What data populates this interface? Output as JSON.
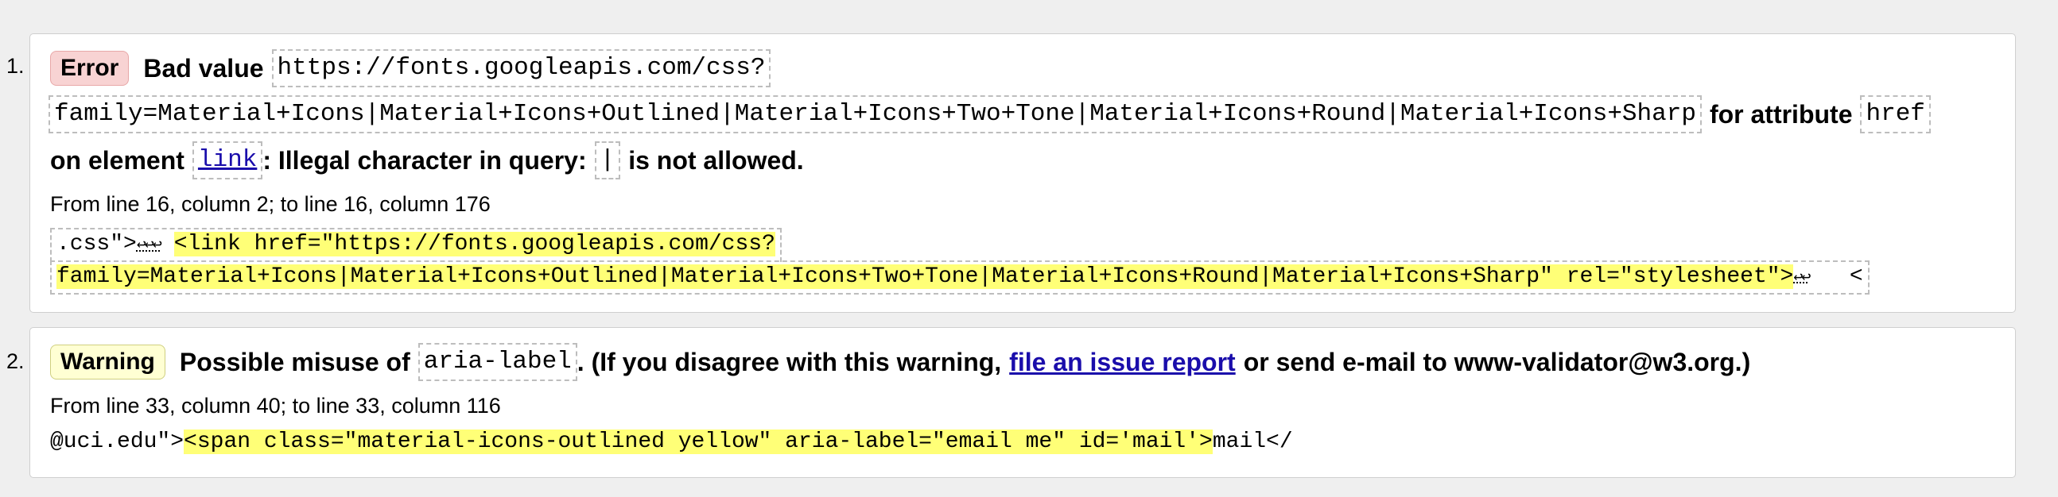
{
  "messages": [
    {
      "number": "1.",
      "type_label": "Error",
      "line1_prefix": "Bad value",
      "url_part1": "https://fonts.googleapis.com/css?",
      "url_part2": "family=Material+Icons|Material+Icons+Outlined|Material+Icons+Two+Tone|Material+Icons+Round|Material+Icons+Sharp",
      "for_attribute_text": "for attribute",
      "attribute_name": "href",
      "on_element_text": "on element",
      "element_name": "link",
      "illegal_text": ": Illegal character in query:",
      "illegal_char": "|",
      "not_allowed_text": "is not allowed.",
      "location": "From line 16, column 2; to line 16, column 176",
      "extract_before": ".css\">",
      "extract_returns_1": "↩↩↩",
      "extract_highlight_1": "<link href=\"https://fonts.googleapis.com/css?",
      "extract_highlight_2": "family=Material+Icons|Material+Icons+Outlined|Material+Icons+Two+Tone|Material+Icons+Round|Material+Icons+Sharp\" rel=\"stylesheet\">",
      "extract_returns_2": "↩↩",
      "extract_after": "<"
    },
    {
      "number": "2.",
      "type_label": "Warning",
      "line1_prefix": "Possible misuse of",
      "attribute_name": "aria-label",
      "line1_middle": ". (If you disagree with this warning,",
      "issue_link": "file an issue report",
      "line1_suffix": "or send e-mail to www-validator@w3.org.)",
      "location": "From line 33, column 40; to line 33, column 116",
      "extract_before": "@uci.edu\">",
      "extract_highlight": "<span class=\"material-icons-outlined yellow\" aria-label=\"email me\" id='mail'>",
      "extract_after": "mail</"
    }
  ]
}
